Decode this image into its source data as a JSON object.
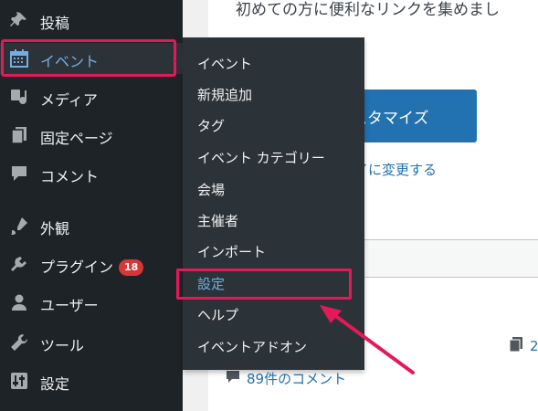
{
  "sidebar": {
    "items": [
      {
        "label": "投稿",
        "icon": "pin-icon"
      },
      {
        "label": "イベント",
        "icon": "calendar-icon",
        "current": true
      },
      {
        "label": "メディア",
        "icon": "media-icon"
      },
      {
        "label": "固定ページ",
        "icon": "pages-icon"
      },
      {
        "label": "コメント",
        "icon": "comment-icon"
      },
      {
        "label": "外観",
        "icon": "appearance-icon"
      },
      {
        "label": "プラグイン",
        "icon": "plugin-icon",
        "badge": "18"
      },
      {
        "label": "ユーザー",
        "icon": "user-icon"
      },
      {
        "label": "ツール",
        "icon": "wrench-icon"
      },
      {
        "label": "設定",
        "icon": "settings-icon"
      }
    ]
  },
  "flyout": {
    "items": [
      {
        "label": "イベント"
      },
      {
        "label": "新規追加"
      },
      {
        "label": "タグ"
      },
      {
        "label": "イベント カテゴリー"
      },
      {
        "label": "会場"
      },
      {
        "label": "主催者"
      },
      {
        "label": "インポート"
      },
      {
        "label": "設定",
        "active": true
      },
      {
        "label": "ヘルプ"
      },
      {
        "label": "イベントアドオン"
      }
    ]
  },
  "main": {
    "intro_text": "初めての方に便利なリンクを集めまし",
    "customize_button": "スタマイズ",
    "theme_link": "イに変更する",
    "comments_link": "89件のコメント",
    "pages_count": "2"
  },
  "colors": {
    "sidebar_bg": "#1d2327",
    "flyout_bg": "#2c3338",
    "accent_blue": "#72aee6",
    "button_blue": "#2271b1",
    "highlight_pink": "#e5185a",
    "badge_red": "#d63638"
  }
}
